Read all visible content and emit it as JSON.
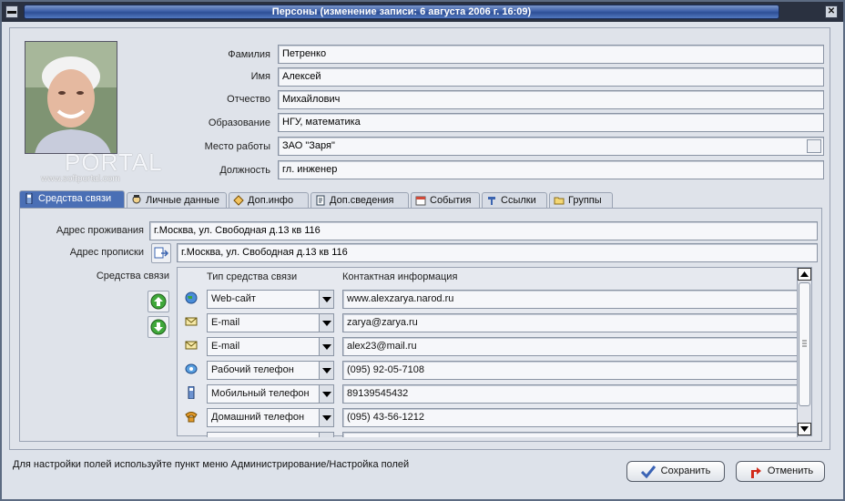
{
  "window": {
    "title": "Персоны  (изменение записи: 6 августа 2006 г. 16:09)",
    "min_btn": "▬",
    "close_btn": "✕"
  },
  "watermark": {
    "text": "PORTAL",
    "subtext": "www.softportal.com"
  },
  "form": {
    "surname": {
      "label": "Фамилия",
      "value": "Петренко"
    },
    "name": {
      "label": "Имя",
      "value": "Алексей"
    },
    "patronymic": {
      "label": "Отчество",
      "value": "Михайлович"
    },
    "education": {
      "label": "Образование",
      "value": "НГУ, математика"
    },
    "workplace": {
      "label": "Место работы",
      "value": "ЗАО \"Заря\""
    },
    "position": {
      "label": "Должность",
      "value": "гл. инженер"
    }
  },
  "tabs": [
    {
      "label": "Средства связи",
      "icon": "phone-icon",
      "active": true
    },
    {
      "label": "Личные данные",
      "icon": "person-icon"
    },
    {
      "label": "Доп.инфо",
      "icon": "info-icon"
    },
    {
      "label": "Доп.сведения",
      "icon": "document-icon"
    },
    {
      "label": "События",
      "icon": "calendar-icon"
    },
    {
      "label": "Ссылки",
      "icon": "link-icon"
    },
    {
      "label": "Группы",
      "icon": "folder-icon"
    }
  ],
  "contact": {
    "address_residence": {
      "label": "Адрес проживания",
      "value": "г.Москва, ул. Свободная д.13 кв 116"
    },
    "address_registration": {
      "label": "Адрес прописки",
      "value": "г.Москва, ул. Свободная д.13 кв 116"
    },
    "means_label": "Средства связи",
    "col_type": "Тип средства связи",
    "col_info": "Контактная информация",
    "rows": [
      {
        "type": "Web-сайт",
        "value": "www.alexzarya.narod.ru",
        "icon": "globe-icon"
      },
      {
        "type": "E-mail",
        "value": "zarya@zarya.ru",
        "icon": "envelope-icon"
      },
      {
        "type": "E-mail",
        "value": "alex23@mail.ru",
        "icon": "envelope-icon"
      },
      {
        "type": "Рабочий телефон",
        "value": "(095) 92-05-7108",
        "icon": "phone-icon"
      },
      {
        "type": "Мобильный телефон",
        "value": "89139545432",
        "icon": "mobile-icon"
      },
      {
        "type": "Домашний телефон",
        "value": "(095) 43-56-1212",
        "icon": "home-phone-icon"
      }
    ]
  },
  "footer": {
    "hint": "Для настройки полей используйте пункт меню Администрирование/Настройка полей",
    "save": "Сохранить",
    "cancel": "Отменить"
  },
  "colors": {
    "title_bar": "#3d5fa8",
    "active_tab": "#4a6fb5",
    "window_bg": "#dde2ea"
  }
}
